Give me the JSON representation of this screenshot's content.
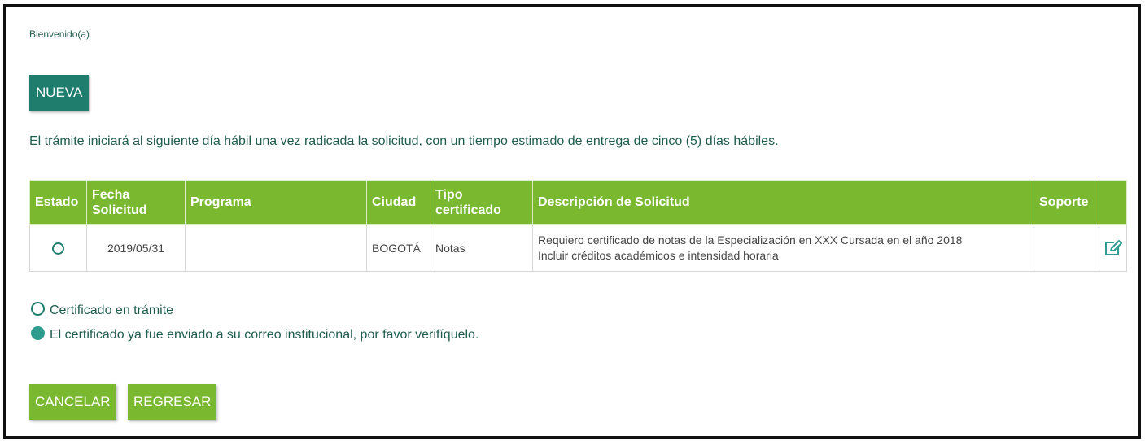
{
  "header": {
    "welcome": "Bienvenido(a)"
  },
  "actions": {
    "new_label": "NUEVA",
    "cancel_label": "CANCELAR",
    "back_label": "REGRESAR"
  },
  "notice": "El trámite iniciará al siguiente día hábil una vez radicada la solicitud, con un tiempo estimado de entrega de cinco (5) días hábiles.",
  "table": {
    "columns": {
      "estado": "Estado",
      "fecha_1": "Fecha",
      "fecha_2": "Solicitud",
      "programa": "Programa",
      "ciudad": "Ciudad",
      "tipo_1": "Tipo",
      "tipo_2": "certificado",
      "descripcion": "Descripción de Solicitud",
      "soporte": "Soporte"
    },
    "rows": [
      {
        "estado": "en trámite",
        "fecha": "2019/05/31",
        "programa": "",
        "ciudad": "BOGOTÁ",
        "tipo": "Notas",
        "descripcion_1": "Requiero certificado de notas de la Especialización en XXX Cursada en el año 2018",
        "descripcion_2": "Incluir créditos académicos e intensidad horaria",
        "soporte": ""
      }
    ]
  },
  "legend": {
    "in_progress": "Certificado en trámite",
    "sent": "El certificado ya fue enviado a su correo institucional, por favor verifíquelo."
  },
  "colors": {
    "header_green": "#7ab92f",
    "teal": "#1f7d6e",
    "teal_fill": "#2e9d8f",
    "text": "#1f5c4e"
  },
  "icons": {
    "edit": "edit-icon",
    "status_open": "status-ring-icon"
  }
}
